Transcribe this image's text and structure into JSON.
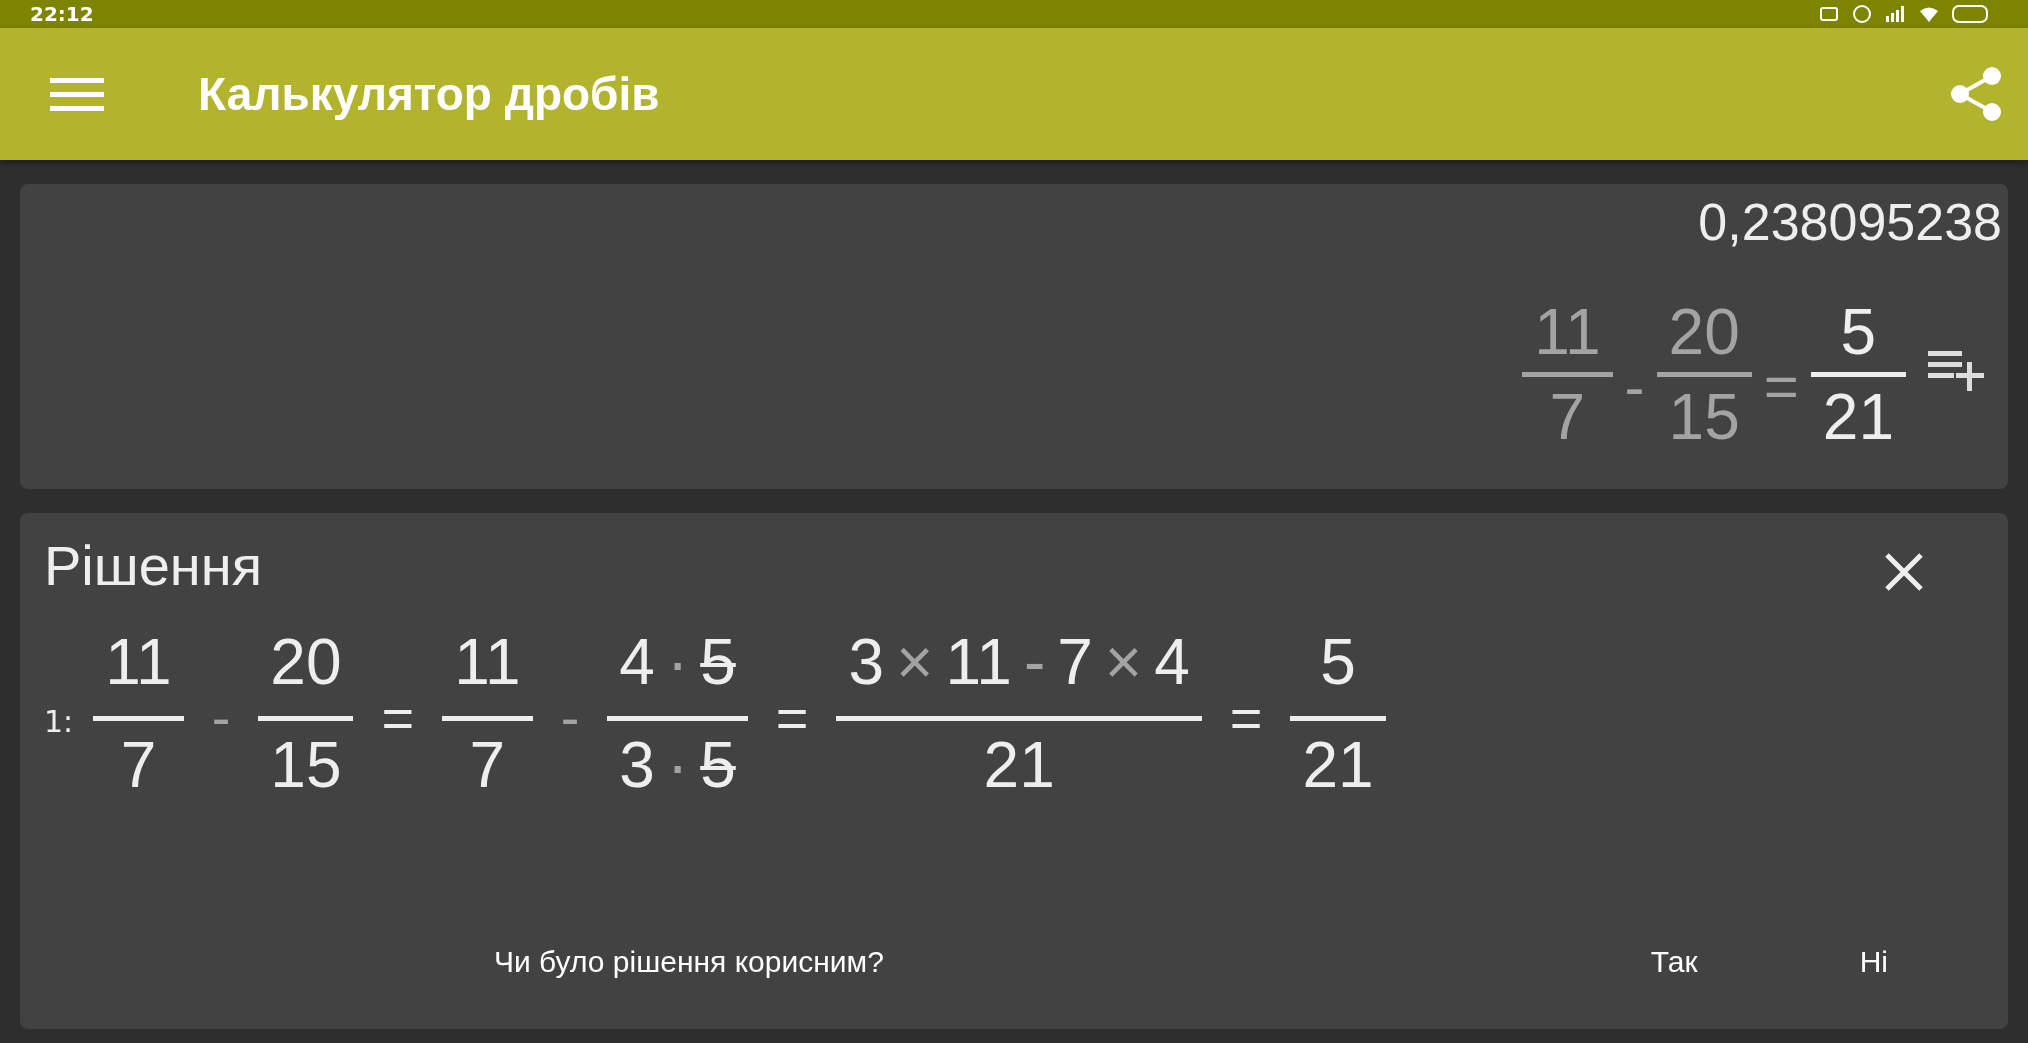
{
  "status_bar": {
    "time": "22:12"
  },
  "app_bar": {
    "title": "Калькулятор дробів"
  },
  "result": {
    "decimal": "0,238095238",
    "expression": [
      {
        "kind": "fraction",
        "muted": true,
        "numerator": [
          {
            "kind": "number",
            "text": "11"
          }
        ],
        "denominator": [
          {
            "kind": "number",
            "text": "7"
          }
        ]
      },
      {
        "kind": "operator",
        "muted": true,
        "text": "-"
      },
      {
        "kind": "fraction",
        "muted": true,
        "numerator": [
          {
            "kind": "number",
            "text": "20"
          }
        ],
        "denominator": [
          {
            "kind": "number",
            "text": "15"
          }
        ]
      },
      {
        "kind": "operator",
        "muted": true,
        "text": "="
      },
      {
        "kind": "fraction",
        "muted": false,
        "numerator": [
          {
            "kind": "number",
            "text": "5"
          }
        ],
        "denominator": [
          {
            "kind": "number",
            "text": "21"
          }
        ]
      }
    ]
  },
  "solution": {
    "title": "Рішення",
    "steps": [
      {
        "label": "1:",
        "expression": [
          {
            "kind": "fraction",
            "muted": false,
            "numerator": [
              {
                "kind": "number",
                "text": "11"
              }
            ],
            "denominator": [
              {
                "kind": "number",
                "text": "7"
              }
            ]
          },
          {
            "kind": "operator",
            "muted": true,
            "text": "-"
          },
          {
            "kind": "fraction",
            "muted": false,
            "numerator": [
              {
                "kind": "number",
                "text": "20"
              }
            ],
            "denominator": [
              {
                "kind": "number",
                "text": "15"
              }
            ]
          },
          {
            "kind": "operator",
            "muted": false,
            "text": "="
          },
          {
            "kind": "fraction",
            "muted": false,
            "numerator": [
              {
                "kind": "number",
                "text": "11"
              }
            ],
            "denominator": [
              {
                "kind": "number",
                "text": "7"
              }
            ]
          },
          {
            "kind": "operator",
            "muted": true,
            "text": "-"
          },
          {
            "kind": "fraction",
            "muted": false,
            "numerator": [
              {
                "kind": "number",
                "text": "4"
              },
              {
                "kind": "operator",
                "text": "·"
              },
              {
                "kind": "cancelled",
                "text": "5"
              }
            ],
            "denominator": [
              {
                "kind": "number",
                "text": "3"
              },
              {
                "kind": "operator",
                "text": "·"
              },
              {
                "kind": "cancelled",
                "text": "5"
              }
            ]
          },
          {
            "kind": "operator",
            "muted": false,
            "text": "="
          },
          {
            "kind": "fraction",
            "muted": false,
            "numerator": [
              {
                "kind": "number",
                "text": "3"
              },
              {
                "kind": "operator",
                "text": "×"
              },
              {
                "kind": "number",
                "text": "11"
              },
              {
                "kind": "operator",
                "text": "-"
              },
              {
                "kind": "number",
                "text": "7"
              },
              {
                "kind": "operator",
                "text": "×"
              },
              {
                "kind": "number",
                "text": "4"
              }
            ],
            "denominator": [
              {
                "kind": "number",
                "text": "21"
              }
            ]
          },
          {
            "kind": "operator",
            "muted": false,
            "text": "="
          },
          {
            "kind": "fraction",
            "muted": false,
            "numerator": [
              {
                "kind": "number",
                "text": "5"
              }
            ],
            "denominator": [
              {
                "kind": "number",
                "text": "21"
              }
            ]
          }
        ]
      }
    ]
  },
  "feedback": {
    "question": "Чи було рішення корисним?",
    "buttons": [
      "Так",
      "Ні"
    ]
  }
}
